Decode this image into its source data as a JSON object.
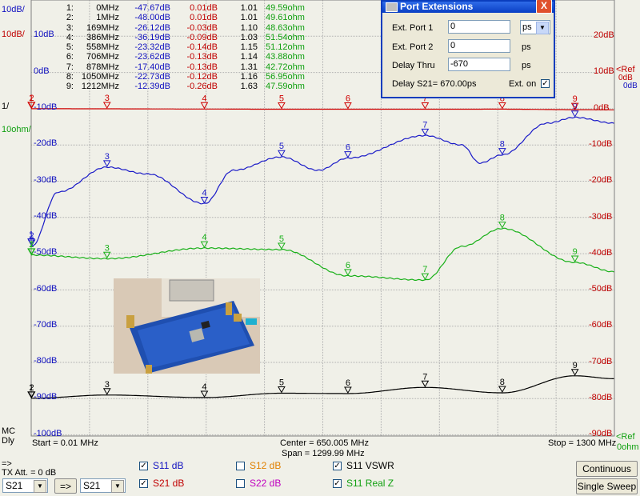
{
  "left_scales": [
    "10dB/",
    "10dB/",
    "1/",
    "10ohm/"
  ],
  "left_top_labels": [
    "10dB",
    "0dB"
  ],
  "left_db_labels": [
    "-10dB",
    "-20dB",
    "-30dB",
    "-40dB",
    "-50dB",
    "-60dB",
    "-70dB",
    "-80dB",
    "-90dB",
    "-100dB"
  ],
  "right_red_labels": [
    "20dB",
    "10dB",
    "0dB",
    "-10dB",
    "-20dB",
    "-30dB",
    "-40dB",
    "-50dB",
    "-60dB",
    "-70dB",
    "-80dB",
    "-90dB"
  ],
  "right_ref_top": "<Ref",
  "right_ref_top2": "0dB",
  "right_ref_top3": "0dB",
  "right_ref_bottom": "<Ref",
  "right_ref_bottom2": "0ohm",
  "mc_label": "MC",
  "dly_label": "Dly",
  "start_label": "Start = 0.01 MHz",
  "center_label": "Center = 650.005 MHz",
  "span_label": "Span = 1299.99 MHz",
  "stop_label": "Stop = 1300 MHz",
  "markers": [
    {
      "n": "1:",
      "f": "0MHz",
      "s11": "-47.67dB",
      "s21": "0.01dB",
      "vswr": "1.01",
      "z": "49.59ohm"
    },
    {
      "n": "2:",
      "f": "1MHz",
      "s11": "-48.00dB",
      "s21": "0.01dB",
      "vswr": "1.01",
      "z": "49.61ohm"
    },
    {
      "n": "3:",
      "f": "169MHz",
      "s11": "-26.12dB",
      "s21": "-0.03dB",
      "vswr": "1.10",
      "z": "48.63ohm"
    },
    {
      "n": "4:",
      "f": "386MHz",
      "s11": "-36.19dB",
      "s21": "-0.09dB",
      "vswr": "1.03",
      "z": "51.54ohm"
    },
    {
      "n": "5:",
      "f": "558MHz",
      "s11": "-23.32dB",
      "s21": "-0.14dB",
      "vswr": "1.15",
      "z": "51.12ohm"
    },
    {
      "n": "6:",
      "f": "706MHz",
      "s11": "-23.62dB",
      "s21": "-0.13dB",
      "vswr": "1.14",
      "z": "43.88ohm"
    },
    {
      "n": "7:",
      "f": "878MHz",
      "s11": "-17.40dB",
      "s21": "-0.13dB",
      "vswr": "1.31",
      "z": "42.72ohm"
    },
    {
      "n": "8:",
      "f": "1050MHz",
      "s11": "-22.73dB",
      "s21": "-0.12dB",
      "vswr": "1.16",
      "z": "56.95ohm"
    },
    {
      "n": "9:",
      "f": "1212MHz",
      "s11": "-12.39dB",
      "s21": "-0.26dB",
      "vswr": "1.63",
      "z": "47.59ohm"
    }
  ],
  "dialog": {
    "title": "Port Extensions",
    "close": "X",
    "ext1_label": "Ext. Port 1",
    "ext1_value": "0",
    "ext2_label": "Ext. Port 2",
    "ext2_value": "0",
    "delay_label": "Delay Thru",
    "delay_value": "-670",
    "unit_select": "ps",
    "unit2": "ps",
    "unit3": "ps",
    "delay_s21": "Delay S21= 670.00ps",
    "ext_on_label": "Ext. on",
    "ext_on_checked": "✓"
  },
  "bottom": {
    "arrow_label": "=>",
    "tx_att": "TX Att. = 0 dB",
    "sel_left": "S21",
    "copy_btn": "=>",
    "sel_right": "S21",
    "checks": [
      {
        "label": "S11  dB",
        "checked": "✓",
        "color": "#1010c0"
      },
      {
        "label": "S21  dB",
        "checked": "✓",
        "color": "#c00000"
      },
      {
        "label": "S12  dB",
        "checked": "",
        "color": "#e08000"
      },
      {
        "label": "S22  dB",
        "checked": "",
        "color": "#c000c0"
      },
      {
        "label": "S11  VSWR",
        "checked": "✓",
        "color": "#000000"
      },
      {
        "label": "S11  Real Z",
        "checked": "✓",
        "color": "#10a010"
      }
    ],
    "continuous_btn": "Continuous",
    "single_btn": "Single Sweep"
  },
  "colors": {
    "s11": "#1a1ac8",
    "s21": "#d00000",
    "vswr": "#000000",
    "realz": "#18b018",
    "grid": "#b0b0b0"
  },
  "chart_data": {
    "type": "line",
    "x_unit": "MHz",
    "xlim": [
      0.01,
      1300
    ],
    "series": [
      {
        "name": "S11 dB",
        "points": [
          [
            0,
            -47.67
          ],
          [
            1,
            -48.0
          ],
          [
            60,
            -33
          ],
          [
            169,
            -26.12
          ],
          [
            260,
            -28
          ],
          [
            386,
            -36.19
          ],
          [
            450,
            -27
          ],
          [
            558,
            -23.32
          ],
          [
            640,
            -27
          ],
          [
            706,
            -23.62
          ],
          [
            878,
            -17.4
          ],
          [
            960,
            -20
          ],
          [
            1000,
            -25
          ],
          [
            1050,
            -22.73
          ],
          [
            1150,
            -14
          ],
          [
            1212,
            -12.39
          ],
          [
            1300,
            -14
          ]
        ]
      },
      {
        "name": "S21 dB",
        "points": [
          [
            0,
            0.01
          ],
          [
            1,
            0.01
          ],
          [
            169,
            -0.03
          ],
          [
            386,
            -0.09
          ],
          [
            558,
            -0.14
          ],
          [
            706,
            -0.13
          ],
          [
            878,
            -0.13
          ],
          [
            1050,
            -0.12
          ],
          [
            1212,
            -0.26
          ],
          [
            1300,
            -0.3
          ]
        ]
      },
      {
        "name": "S11 VSWR",
        "points": [
          [
            0,
            1.01
          ],
          [
            1,
            1.01
          ],
          [
            169,
            1.1
          ],
          [
            386,
            1.03
          ],
          [
            558,
            1.15
          ],
          [
            706,
            1.14
          ],
          [
            878,
            1.31
          ],
          [
            1050,
            1.16
          ],
          [
            1212,
            1.63
          ],
          [
            1300,
            1.55
          ]
        ]
      },
      {
        "name": "S11 Real Z",
        "points": [
          [
            0,
            49.59
          ],
          [
            1,
            49.61
          ],
          [
            169,
            48.63
          ],
          [
            386,
            51.54
          ],
          [
            558,
            51.12
          ],
          [
            706,
            43.88
          ],
          [
            878,
            42.72
          ],
          [
            960,
            52
          ],
          [
            1050,
            56.95
          ],
          [
            1212,
            47.59
          ],
          [
            1300,
            45
          ]
        ]
      }
    ]
  }
}
